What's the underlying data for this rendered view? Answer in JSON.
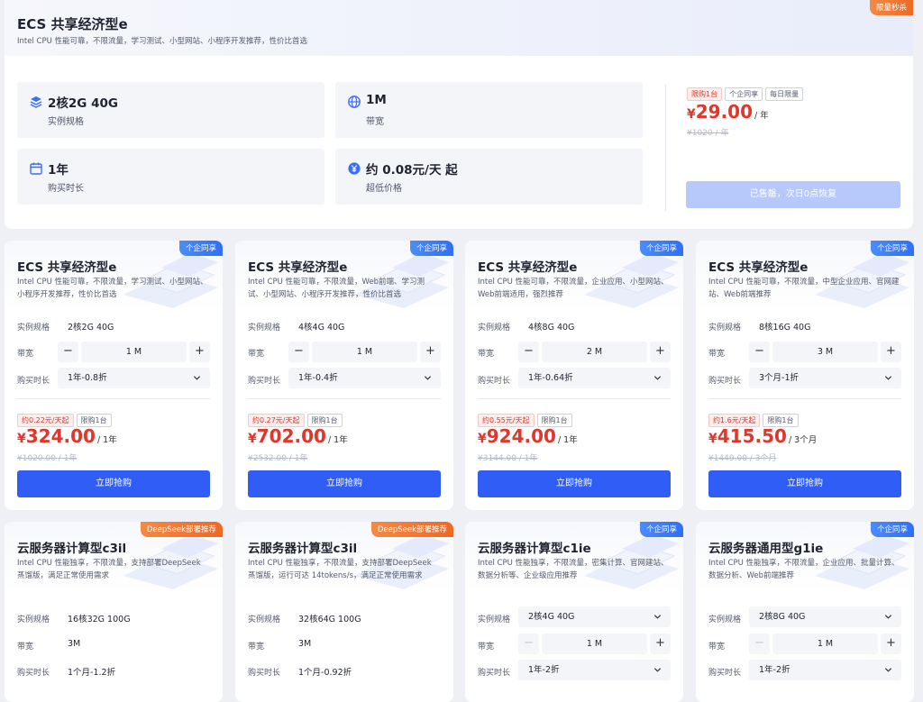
{
  "hero": {
    "title": "ECS 共享经济型e",
    "subtitle": "Intel CPU 性能可靠，不限流量，学习测试、小型网站、小程序开发推荐，性价比首选",
    "corner_tag": "限量秒杀",
    "specs": [
      {
        "value": "2核2G 40G",
        "label": "实例规格",
        "icon": "layers-icon"
      },
      {
        "value": "1M",
        "label": "带宽",
        "icon": "globe-icon"
      },
      {
        "value": "1年",
        "label": "购买时长",
        "icon": "calendar-icon"
      },
      {
        "value": "约 0.08元/天 起",
        "label": "超低价格",
        "icon": "yuan-icon"
      }
    ],
    "badges": [
      "限购1台",
      "个企同享",
      "每日限量"
    ],
    "currency": "¥",
    "price": "29.00",
    "price_unit": "/ 年",
    "original_price": "¥1020 / 年",
    "button_label": "已售罄，次日0点恢复"
  },
  "labels": {
    "instance_spec": "实例规格",
    "bandwidth": "带宽",
    "duration": "购买时长",
    "limit": "限购1台",
    "buy": "立即抢购"
  },
  "cards": [
    {
      "corner_tag": "个企同享",
      "title": "ECS 共享经济型e",
      "desc": "Intel CPU 性能可靠，不限流量，学习测试、小型网站、小程序开发推荐，性价比首选",
      "spec": "2核2G 40G",
      "bandwidth": "1 M",
      "duration": "1年-0.8折",
      "daily": "约0.22元/天起",
      "price": "324.00",
      "unit": "/ 1年",
      "original": "¥1020.00 / 1年"
    },
    {
      "corner_tag": "个企同享",
      "title": "ECS 共享经济型e",
      "desc": "Intel CPU 性能可靠，不限流量，Web前端、学习测试、小型网站、小程序开发推荐，性价比首选",
      "spec": "4核4G 40G",
      "bandwidth": "1 M",
      "duration": "1年-0.4折",
      "daily": "约0.27元/天起",
      "price": "702.00",
      "unit": "/ 1年",
      "original": "¥2532.00 / 1年"
    },
    {
      "corner_tag": "个企同享",
      "title": "ECS 共享经济型e",
      "desc": "Intel CPU 性能可靠，不限流量，企业应用、小型网站、Web前端适用，强烈推荐",
      "spec": "4核8G 40G",
      "bandwidth": "2 M",
      "duration": "1年-0.64折",
      "daily": "约0.55元/天起",
      "price": "924.00",
      "unit": "/ 1年",
      "original": "¥3144.00 / 1年"
    },
    {
      "corner_tag": "个企同享",
      "title": "ECS 共享经济型e",
      "desc": "Intel CPU 性能可靠，不限流量，中型企业应用、官网建站、Web前端推荐",
      "spec": "8核16G 40G",
      "bandwidth": "3 M",
      "duration": "3个月-1折",
      "daily": "约1.6元/天起",
      "price": "415.50",
      "unit": "/ 3个月",
      "original": "¥1449.00 / 3个月"
    }
  ],
  "cards2": [
    {
      "corner_tag": "DeepSeek部署推荐",
      "title": "云服务器计算型c3il",
      "desc": "Intel CPU 性能独享，不限流量，支持部署DeepSeek蒸馏版，满足正常使用需求",
      "spec": "16核32G 100G",
      "bandwidth": "3M",
      "duration": "1个月-1.2折"
    },
    {
      "corner_tag": "DeepSeek部署推荐",
      "title": "云服务器计算型c3il",
      "desc": "Intel CPU 性能独享，不限流量，支持部署DeepSeek蒸馏版，运行可达 14tokens/s，满足正常使用需求",
      "spec": "32核64G 100G",
      "bandwidth": "3M",
      "duration": "1个月-0.92折"
    },
    {
      "corner_tag": "个企同享",
      "title": "云服务器计算型c1ie",
      "desc": "Intel CPU 性能独享，不限流量，密集计算、官网建站、数据分析等、企业级应用推荐",
      "spec": "2核4G 40G",
      "bandwidth": "1 M",
      "duration": "1年-2折"
    },
    {
      "corner_tag": "个企同享",
      "title": "云服务器通用型g1ie",
      "desc": "Intel CPU 性能独享，不限流量，企业应用、批量计算、数据分析、Web前端推荐",
      "spec": "2核8G 40G",
      "bandwidth": "1 M",
      "duration": "1年-2折"
    }
  ],
  "currency": "¥",
  "colors": {
    "accent": "#2f5df5",
    "price": "#e1362b",
    "tag_blue": "#2f6ff5",
    "tag_orange": "#ec6a24"
  }
}
